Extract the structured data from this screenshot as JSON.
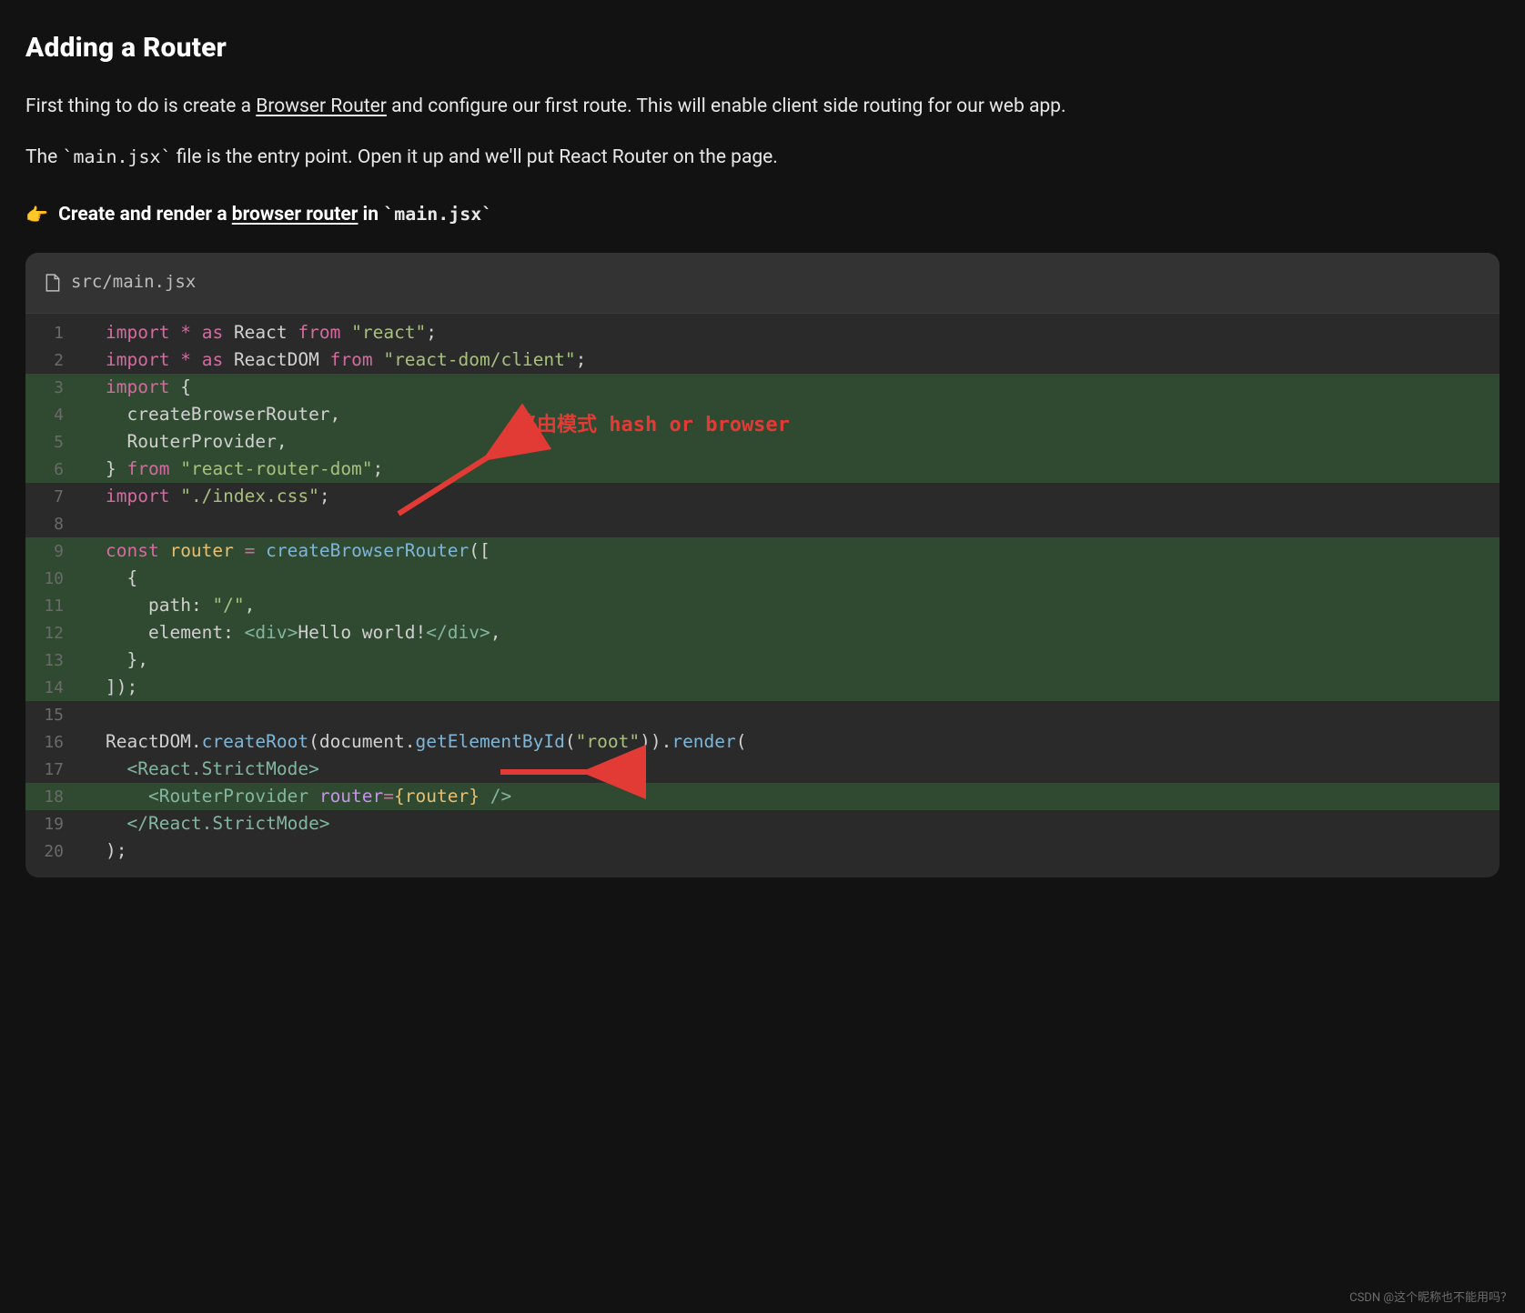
{
  "heading": "Adding a Router",
  "intro": {
    "pre": "First thing to do is create a ",
    "link": "Browser Router",
    "post": " and configure our first route. This will enable client side routing for our web app."
  },
  "para2": {
    "pre": "The ",
    "code": "`main.jsx`",
    "post": " file is the entry point. Open it up and we'll put React Router on the page."
  },
  "step": {
    "emoji": "👉",
    "pre": " Create and render a ",
    "link": "browser router",
    "mid": " in ",
    "code": "`main.jsx`"
  },
  "code": {
    "filename": "src/main.jsx",
    "lines": [
      {
        "n": 1,
        "hl": false
      },
      {
        "n": 2,
        "hl": false
      },
      {
        "n": 3,
        "hl": true
      },
      {
        "n": 4,
        "hl": true
      },
      {
        "n": 5,
        "hl": true
      },
      {
        "n": 6,
        "hl": true
      },
      {
        "n": 7,
        "hl": false
      },
      {
        "n": 8,
        "hl": false
      },
      {
        "n": 9,
        "hl": true
      },
      {
        "n": 10,
        "hl": true
      },
      {
        "n": 11,
        "hl": true
      },
      {
        "n": 12,
        "hl": true
      },
      {
        "n": 13,
        "hl": true
      },
      {
        "n": 14,
        "hl": true
      },
      {
        "n": 15,
        "hl": false
      },
      {
        "n": 16,
        "hl": false
      },
      {
        "n": 17,
        "hl": false
      },
      {
        "n": 18,
        "hl": true
      },
      {
        "n": 19,
        "hl": false
      },
      {
        "n": 20,
        "hl": false
      }
    ],
    "tokens": {
      "import": "import",
      "star": "*",
      "as": "as",
      "React": "React",
      "from": "from",
      "react_str": "\"react\"",
      "ReactDOM": "ReactDOM",
      "reactdom_str": "\"react-dom/client\"",
      "lbrace": "{",
      "rbrace": "}",
      "createBrowserRouter": "createBrowserRouter",
      "RouterProvider": "RouterProvider",
      "rrdom_str": "\"react-router-dom\"",
      "indexcss_str": "\"./index.css\"",
      "const": "const",
      "router": "router",
      "eq": "=",
      "lbracket": "[",
      "rbracket": "]",
      "lparen": "(",
      "rparen": ")",
      "path": "path",
      "colon": ":",
      "slash_str": "\"/\"",
      "comma": ",",
      "element": "element",
      "div_open": "<div>",
      "hello": "Hello world!",
      "div_close": "</div>",
      "semicolon": ";",
      "createRoot": "createRoot",
      "document": "document",
      "getElementById": "getElementById",
      "root_str": "\"root\"",
      "render": "render",
      "ReactStrict_open": "<React.StrictMode>",
      "ReactStrict_close": "</React.StrictMode>",
      "RouterProvider_open": "<RouterProvider",
      "router_attr": "router",
      "router_val": "{router}",
      "selfclose": "/>"
    }
  },
  "annotation": {
    "text": "路由模式  hash or browser"
  },
  "watermark": "CSDN @这个昵称也不能用吗？"
}
